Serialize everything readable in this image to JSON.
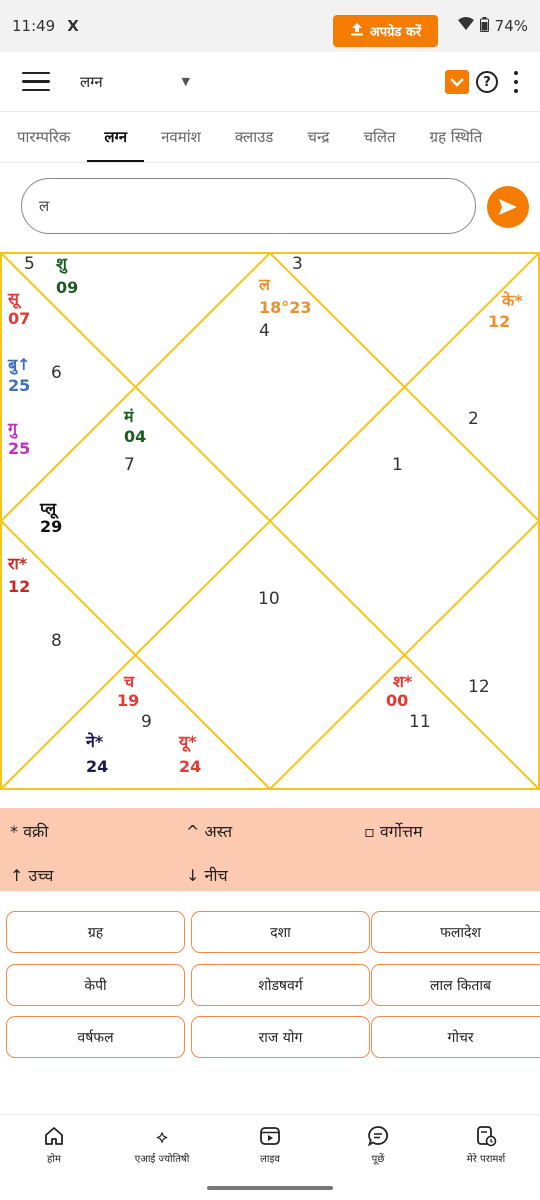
{
  "status_bar": {
    "time": "11:49",
    "notif_icon": "X",
    "battery": "74%"
  },
  "header": {
    "dropdown_value": "लग्न",
    "upgrade_label": "अपग्रेड करें"
  },
  "tabs": [
    "पारम्परिक",
    "लग्न",
    "नवमांश",
    "क्लाउड",
    "चन्द्र",
    "चलित",
    "ग्रह स्थिति"
  ],
  "active_tab": 1,
  "search": {
    "value": "ल"
  },
  "chart": {
    "line_color": "#f5c518",
    "houses": [
      "5",
      "3",
      "6",
      "7",
      "4",
      "1",
      "2",
      "10",
      "8",
      "9",
      "11",
      "12"
    ],
    "planets": [
      {
        "name": "शु",
        "deg": "09",
        "color": "#1b5e20"
      },
      {
        "name": "सू",
        "deg": "07",
        "color": "#e53935"
      },
      {
        "name": "बु↑",
        "deg": "25",
        "color": "#3f6fb5"
      },
      {
        "name": "गु",
        "deg": "25",
        "color": "#c230c2"
      },
      {
        "name": "ल",
        "deg": "18°23",
        "color": "#e8912d"
      },
      {
        "name": "के*",
        "deg": "12",
        "color": "#e8912d"
      },
      {
        "name": "मं",
        "deg": "04",
        "color": "#1b5e20"
      },
      {
        "name": "प्लू",
        "deg": "29",
        "color": "#111111"
      },
      {
        "name": "रा*",
        "deg": "12",
        "color": "#c62828"
      },
      {
        "name": "च",
        "deg": "19",
        "color": "#e53935"
      },
      {
        "name": "ने*",
        "deg": "24",
        "color": "#1a1a4e"
      },
      {
        "name": "यू*",
        "deg": "24",
        "color": "#e53935"
      },
      {
        "name": "श*",
        "deg": "00",
        "color": "#e53935"
      }
    ]
  },
  "legend": {
    "retro": "* वक्री",
    "combust": "^ अस्त",
    "vargottam": "▫ वर्गोत्तम",
    "exalted": "↑ उच्च",
    "debilitated": "↓ नीच"
  },
  "buttons": [
    "ग्रह",
    "दशा",
    "फलादेश",
    "केपी",
    "शोडषवर्ग",
    "लाल किताब",
    "वर्षफल",
    "राज योग",
    "गोचर"
  ],
  "bottom_nav": [
    "होम",
    "एआई ज्योतिषी",
    "लाइव",
    "पूछें",
    "मेरे परामर्श"
  ]
}
